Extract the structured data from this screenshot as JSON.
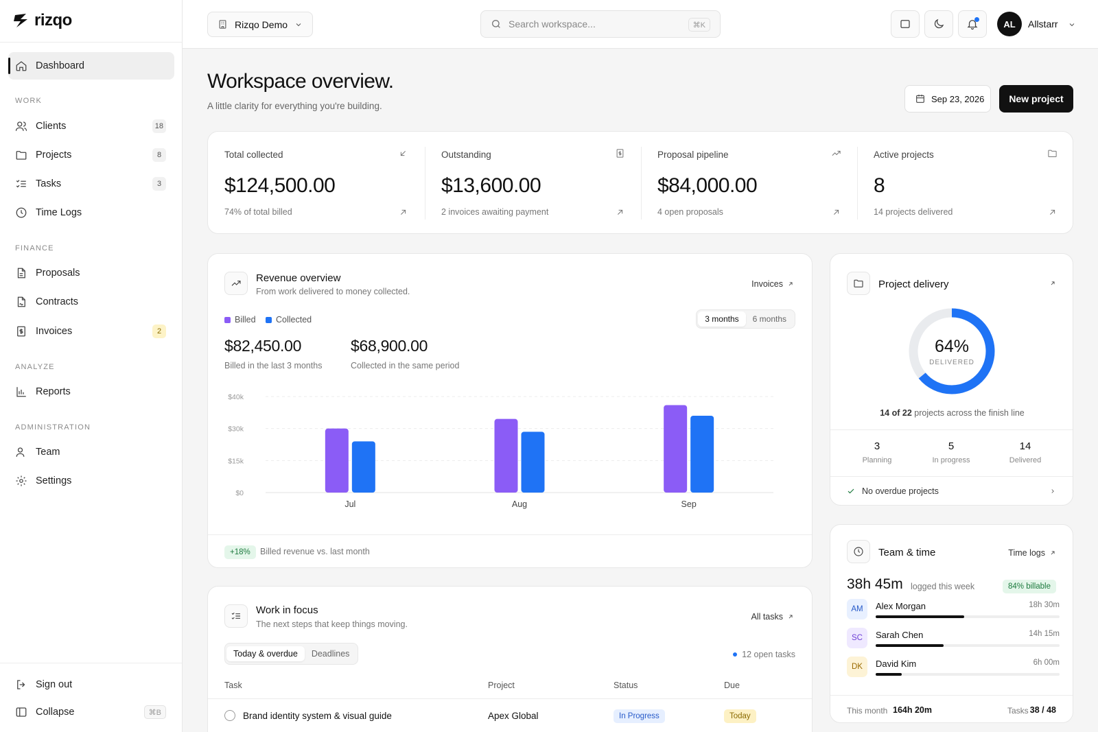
{
  "brand": {
    "name": "rizqo"
  },
  "sidebar": {
    "dashboard": "Dashboard",
    "sections": {
      "work": "WORK",
      "finance": "FINANCE",
      "analyze": "ANALYZE",
      "administration": "ADMINISTRATION"
    },
    "items": {
      "clients": {
        "label": "Clients",
        "badge": "18"
      },
      "projects": {
        "label": "Projects",
        "badge": "8"
      },
      "tasks": {
        "label": "Tasks",
        "badge": "3"
      },
      "timelogs": {
        "label": "Time Logs"
      },
      "proposals": {
        "label": "Proposals"
      },
      "contracts": {
        "label": "Contracts"
      },
      "invoices": {
        "label": "Invoices",
        "badge": "2"
      },
      "reports": {
        "label": "Reports"
      },
      "team": {
        "label": "Team"
      },
      "settings": {
        "label": "Settings"
      }
    },
    "signout": "Sign out",
    "collapse": "Collapse",
    "collapse_kbd": "⌘B"
  },
  "topbar": {
    "workspace": "Rizqo Demo",
    "search_placeholder": "Search workspace...",
    "search_kbd": "⌘K",
    "user_initials": "AL",
    "user_name": "Allstarr"
  },
  "header": {
    "title": "Workspace overview.",
    "subtitle": "A little clarity for everything you're building.",
    "date": "Sep 23, 2026",
    "new_project": "New project"
  },
  "stats": [
    {
      "label": "Total collected",
      "value": "$124,500.00",
      "foot": "74% of total billed",
      "icon": "arrow-down-left-icon"
    },
    {
      "label": "Outstanding",
      "value": "$13,600.00",
      "foot": "2 invoices awaiting payment",
      "icon": "invoice-icon"
    },
    {
      "label": "Proposal pipeline",
      "value": "$84,000.00",
      "foot": "4 open proposals",
      "icon": "trending-up-icon"
    },
    {
      "label": "Active projects",
      "value": "8",
      "foot": "14 projects delivered",
      "icon": "folder-icon"
    }
  ],
  "revenue": {
    "title": "Revenue overview",
    "subtitle": "From work delivered to money collected.",
    "link": "Invoices",
    "legend": {
      "billed": "Billed",
      "collected": "Collected"
    },
    "range": {
      "three": "3 months",
      "six": "6 months",
      "selected": "3 months"
    },
    "billed_total": "$82,450.00",
    "billed_note": "Billed in the last 3 months",
    "collected_total": "$68,900.00",
    "collected_note": "Collected in the same period",
    "footer_pill": "+18%",
    "footer_text": "Billed revenue vs. last month",
    "colors": {
      "billed": "#8b5cf6",
      "collected": "#1f73f5"
    }
  },
  "chart_data": {
    "type": "bar",
    "categories": [
      "Jul",
      "Aug",
      "Sep"
    ],
    "series": [
      {
        "name": "Billed",
        "values": [
          30000,
          34500,
          41000
        ]
      },
      {
        "name": "Collected",
        "values": [
          24000,
          28500,
          36000
        ]
      }
    ],
    "yticks": [
      "$0",
      "$15k",
      "$30k",
      "$40k"
    ],
    "ytick_values": [
      0,
      15000,
      30000,
      45000
    ],
    "ylim": [
      0,
      45000
    ],
    "grid": true
  },
  "delivery": {
    "title": "Project delivery",
    "percent": 64,
    "percent_label": "64%",
    "center_label": "DELIVERED",
    "summary_bold": "14 of 22",
    "summary_rest": "projects across the finish line",
    "planning": {
      "value": "3",
      "label": "Planning"
    },
    "in_progress": {
      "value": "5",
      "label": "In progress"
    },
    "delivered": {
      "value": "14",
      "label": "Delivered"
    },
    "overdue": "No overdue projects"
  },
  "team": {
    "title": "Team & time",
    "link": "Time logs",
    "week_total": "38h 45m",
    "week_note": "logged this week",
    "billable": "84% billable",
    "members": [
      {
        "initials": "AM",
        "name": "Alex Morgan",
        "hours": "18h 30m",
        "share": 0.48,
        "bg": "#e8f0ff",
        "fg": "#2659c8"
      },
      {
        "initials": "SC",
        "name": "Sarah Chen",
        "hours": "14h 15m",
        "share": 0.37,
        "bg": "#efe9ff",
        "fg": "#6d3fd6"
      },
      {
        "initials": "DK",
        "name": "David Kim",
        "hours": "6h 00m",
        "share": 0.14,
        "bg": "#fdf3d6",
        "fg": "#9a6a00"
      }
    ],
    "month_label": "This month",
    "month_value": "164h 20m",
    "tasks_label": "Tasks",
    "tasks_value": "38 / 48"
  },
  "focus": {
    "title": "Work in focus",
    "subtitle": "The next steps that keep things moving.",
    "link": "All tasks",
    "tabs": {
      "today": "Today & overdue",
      "deadlines": "Deadlines"
    },
    "open_tasks": "12 open tasks",
    "headers": {
      "task": "Task",
      "project": "Project",
      "status": "Status",
      "due": "Due"
    },
    "rows": [
      {
        "task": "Brand identity system & visual guide",
        "project": "Apex Global",
        "status": "In Progress",
        "due": "Today"
      }
    ]
  }
}
